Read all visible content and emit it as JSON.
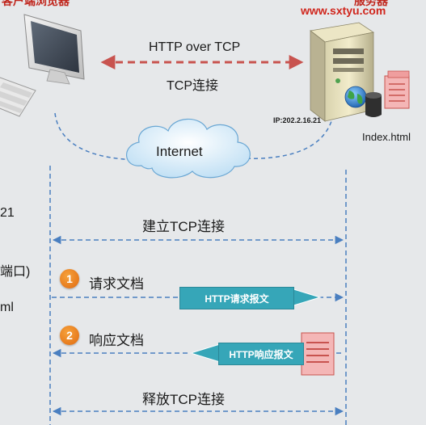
{
  "header": {
    "client_label_cut": "客户端浏览器",
    "server_label_cut": "服务器",
    "server_url": "www.sxtyu.com"
  },
  "connection": {
    "protocol_label": "HTTP over TCP",
    "tcp_label": "TCP连接"
  },
  "cloud": {
    "label": "Internet"
  },
  "server": {
    "ip_label": "IP:202.2.16.21",
    "file_label": "Index.html"
  },
  "left_margin": {
    "line1": "21",
    "line2": "端口)",
    "line3": "ml"
  },
  "sequence": {
    "establish_label": "建立TCP连接",
    "step1_number": "1",
    "step1_label": "请求文档",
    "request_message": "HTTP请求报文",
    "step2_number": "2",
    "step2_label": "响应文档",
    "response_message": "HTTP响应报文",
    "release_label": "释放TCP连接"
  },
  "colors": {
    "background": "#e6e8ea",
    "url_red": "#d0261d",
    "connection_arrow": "#c8534f",
    "dashed_blue": "#4a7fc0",
    "badge_orange": "#e8791c",
    "message_teal": "#36a6b8",
    "document_pink": "#f4b6b6"
  }
}
